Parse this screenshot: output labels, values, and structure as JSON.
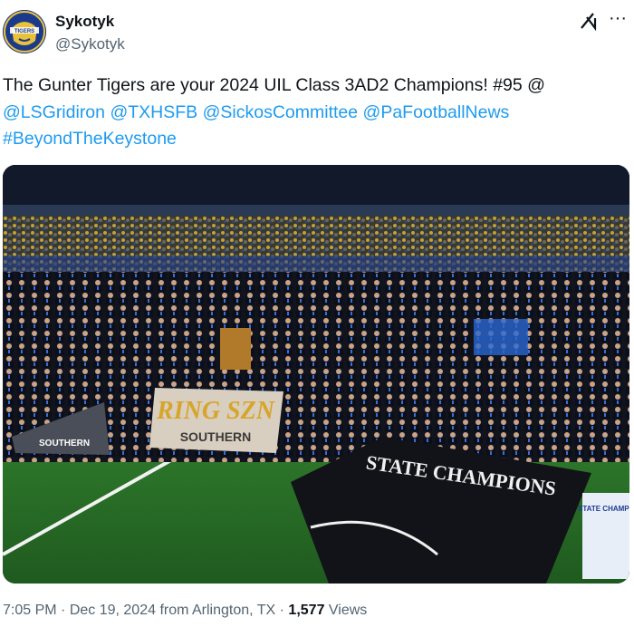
{
  "author": {
    "display_name": "Sykotyk",
    "handle": "@Sykotyk",
    "avatar_text": "TIGERS"
  },
  "icons": {
    "grok": "grok-icon",
    "more": "more-options-icon"
  },
  "tweet": {
    "text_prefix": "The Gunter Tigers are your 2024 UIL Class 3AD2 Champions! #95 @",
    "mentions": [
      "@LSGridiron",
      "@TXHSFB",
      "@SickosCommittee",
      "@PaFootballNews"
    ],
    "hashtag": "#BeyondTheKeystone"
  },
  "media": {
    "banner_main": "RING SZN",
    "banner_sub": "SOUTHERN",
    "flag_text": "STATE CHAMPIONS",
    "sign_text": "STATE CHAMPS",
    "left_sign": "SOUTHERN"
  },
  "meta": {
    "time": "7:05 PM",
    "sep1": " · ",
    "date": "Dec 19, 2024 from Arlington, TX",
    "sep2": " · ",
    "views_count": "1,577",
    "views_label": " Views"
  }
}
